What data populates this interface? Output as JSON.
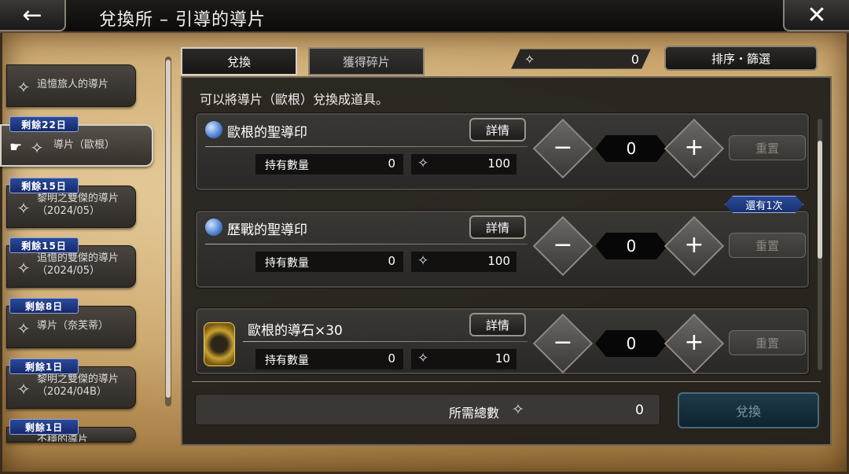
{
  "header": {
    "title": "兌換所 – 引導的導片",
    "back_icon": "←",
    "close_icon": "✕"
  },
  "sidebar": {
    "items": [
      {
        "label": "追憶旅人的導片",
        "badge": ""
      },
      {
        "label": "導片（歐根）",
        "badge": "剩餘22日"
      },
      {
        "label": "黎明之雙傑的導片\n（2024/05）",
        "badge": "剩餘15日"
      },
      {
        "label": "追憶的雙傑的導片\n（2024/05）",
        "badge": "剩餘15日"
      },
      {
        "label": "導片（奈芙蒂）",
        "badge": "剩餘8日"
      },
      {
        "label": "黎明之雙傑的導片\n（2024/04B）",
        "badge": "剩餘1日"
      },
      {
        "label": "不穩的導片",
        "badge": "剩餘1日"
      }
    ]
  },
  "tabs": {
    "exchange": "兌換",
    "fragments": "獲得碎片"
  },
  "currency": {
    "value": "0"
  },
  "sort_label": "排序・篩選",
  "info_text": "可以將導片（歐根）兌換成道具。",
  "detail_label": "詳情",
  "held_label": "持有數量",
  "reset_label": "重置",
  "items": [
    {
      "name": "歐根的聖導印",
      "held": "0",
      "cost": "100",
      "qty": "0"
    },
    {
      "name": "歷戰的聖導印",
      "held": "0",
      "cost": "100",
      "qty": "0",
      "remaining": "還有1次"
    },
    {
      "name": "歐根的導石×30",
      "held": "0",
      "cost": "10",
      "qty": "0"
    }
  ],
  "total": {
    "label": "所需總數",
    "value": "0"
  },
  "exchange_button": "兌換",
  "gem_glyph": "✧"
}
